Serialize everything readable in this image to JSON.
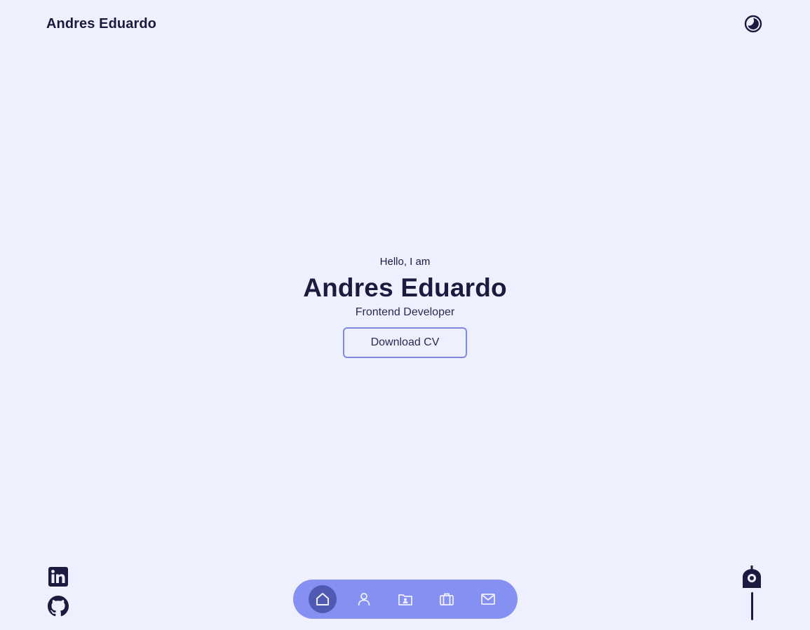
{
  "header": {
    "logo": "Andres Eduardo",
    "theme_toggle_icon": "moon-icon"
  },
  "hero": {
    "greeting": "Hello, I am",
    "name": "Andres Eduardo",
    "role": "Frontend Developer",
    "cv_button": "Download CV"
  },
  "socials": [
    {
      "icon": "linkedin-icon"
    },
    {
      "icon": "github-icon"
    }
  ],
  "nav": {
    "items": [
      {
        "icon": "home-icon",
        "active": true
      },
      {
        "icon": "user-icon",
        "active": false
      },
      {
        "icon": "folder-icon",
        "active": false
      },
      {
        "icon": "briefcase-icon",
        "active": false
      },
      {
        "icon": "mail-icon",
        "active": false
      }
    ]
  },
  "scroll_indicator": {
    "icon": "scroll-icon"
  },
  "colors": {
    "background": "#eef1fd",
    "text": "#1b1a3f",
    "accent": "#7f88e5",
    "navbar": "#868ff2",
    "nav_active": "#515ab3"
  }
}
